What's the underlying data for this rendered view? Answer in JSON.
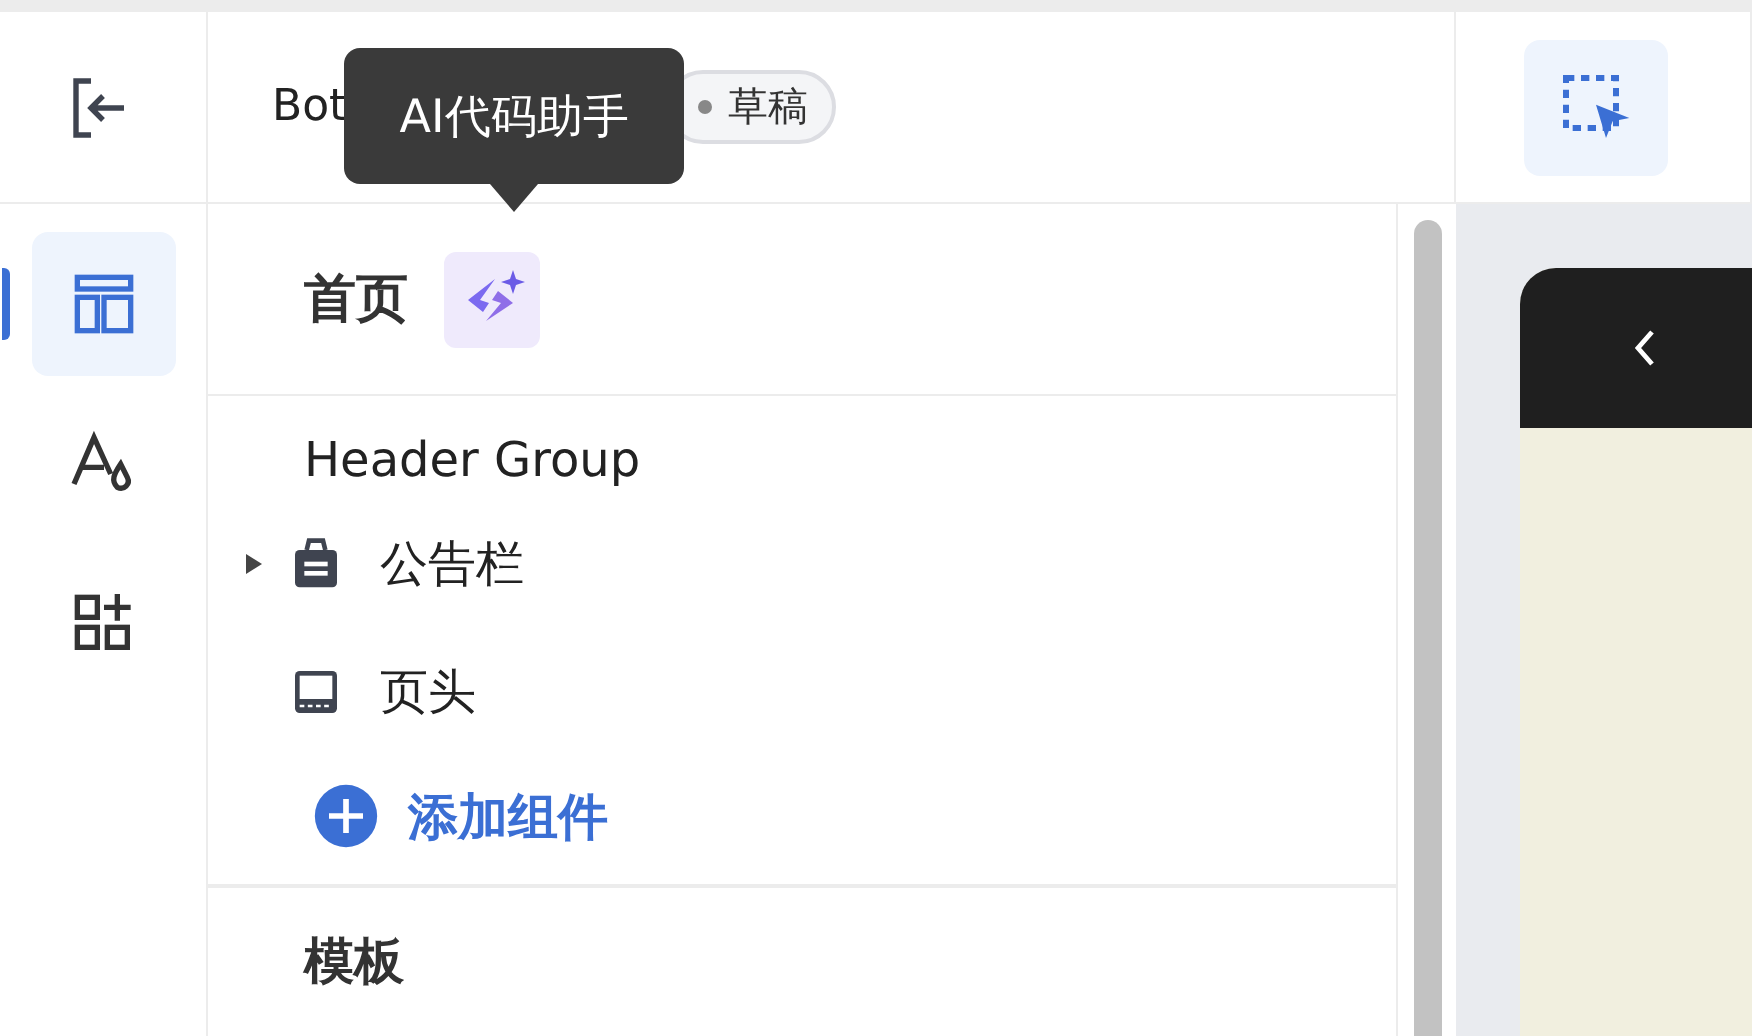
{
  "header": {
    "title": "Bot",
    "status_badge": "草稿",
    "tooltip": "AI代码助手"
  },
  "rail": [
    {
      "kind": "layout",
      "selected": true
    },
    {
      "kind": "style",
      "selected": false
    },
    {
      "kind": "components",
      "selected": false
    }
  ],
  "panel": {
    "page_title": "首页",
    "group_title": "Header Group",
    "tree": [
      {
        "label": "公告栏",
        "kind": "notice",
        "expanded": false
      },
      {
        "label": "页头",
        "kind": "header"
      }
    ],
    "add_button": "添加组件",
    "section_title": "模板"
  }
}
